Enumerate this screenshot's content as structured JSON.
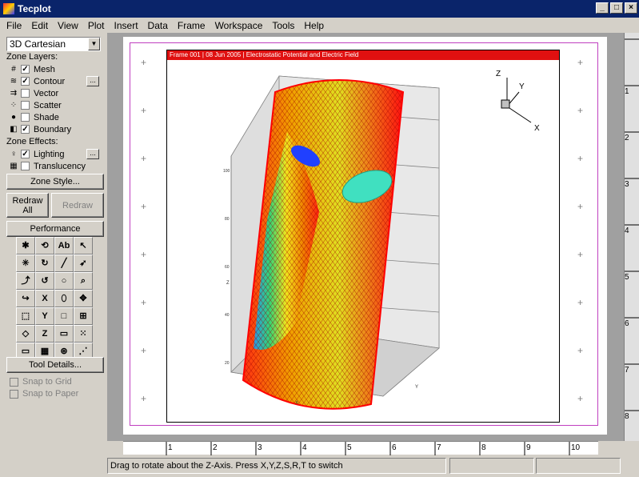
{
  "window": {
    "title": "Tecplot",
    "minimize": "_",
    "maximize": "□",
    "close": "×"
  },
  "menu": [
    "File",
    "Edit",
    "View",
    "Plot",
    "Insert",
    "Data",
    "Frame",
    "Workspace",
    "Tools",
    "Help"
  ],
  "sidebar": {
    "plot_type": "3D Cartesian",
    "zone_layers_label": "Zone Layers:",
    "layers": [
      {
        "label": "Mesh",
        "checked": true,
        "icon": "mesh-icon"
      },
      {
        "label": "Contour",
        "checked": true,
        "icon": "contour-icon"
      },
      {
        "label": "Vector",
        "checked": false,
        "icon": "vector-icon"
      },
      {
        "label": "Scatter",
        "checked": false,
        "icon": "scatter-icon"
      },
      {
        "label": "Shade",
        "checked": false,
        "icon": "shade-icon"
      },
      {
        "label": "Boundary",
        "checked": true,
        "icon": "boundary-icon"
      }
    ],
    "zone_effects_label": "Zone Effects:",
    "effects": [
      {
        "label": "Lighting",
        "checked": true,
        "icon": "lighting-icon"
      },
      {
        "label": "Translucency",
        "checked": false,
        "icon": "translucency-icon"
      }
    ],
    "dots": "...",
    "zone_style": "Zone Style...",
    "redraw_all": "Redraw All",
    "redraw": "Redraw",
    "performance": "Performance",
    "tools": [
      "",
      "",
      "Ab",
      "↖",
      "",
      "",
      "",
      "",
      "",
      "",
      "○",
      "",
      "",
      "",
      "",
      "✥",
      "",
      "Y",
      "□",
      "",
      "",
      "Z",
      "▭",
      "",
      "▭",
      "▦",
      "⊛",
      "⋰"
    ],
    "tool_details": "Tool Details...",
    "snap_grid": "Snap to Grid",
    "snap_paper": "Snap to Paper"
  },
  "frame": {
    "header": "Frame 001  |  08 Jun 2005  |  Electrostatic Potential and Electric Field",
    "axis_x": "X",
    "axis_y": "Y",
    "axis_z": "Z"
  },
  "rulers": {
    "h": [
      "1",
      "2",
      "3",
      "4",
      "5",
      "6",
      "7",
      "8",
      "9",
      "10"
    ],
    "v": [
      "1",
      "2",
      "3",
      "4",
      "5",
      "6",
      "7",
      "8"
    ]
  },
  "status": {
    "text": "Drag to rotate about the Z-Axis.  Press X,Y,Z,S,R,T to switch"
  }
}
